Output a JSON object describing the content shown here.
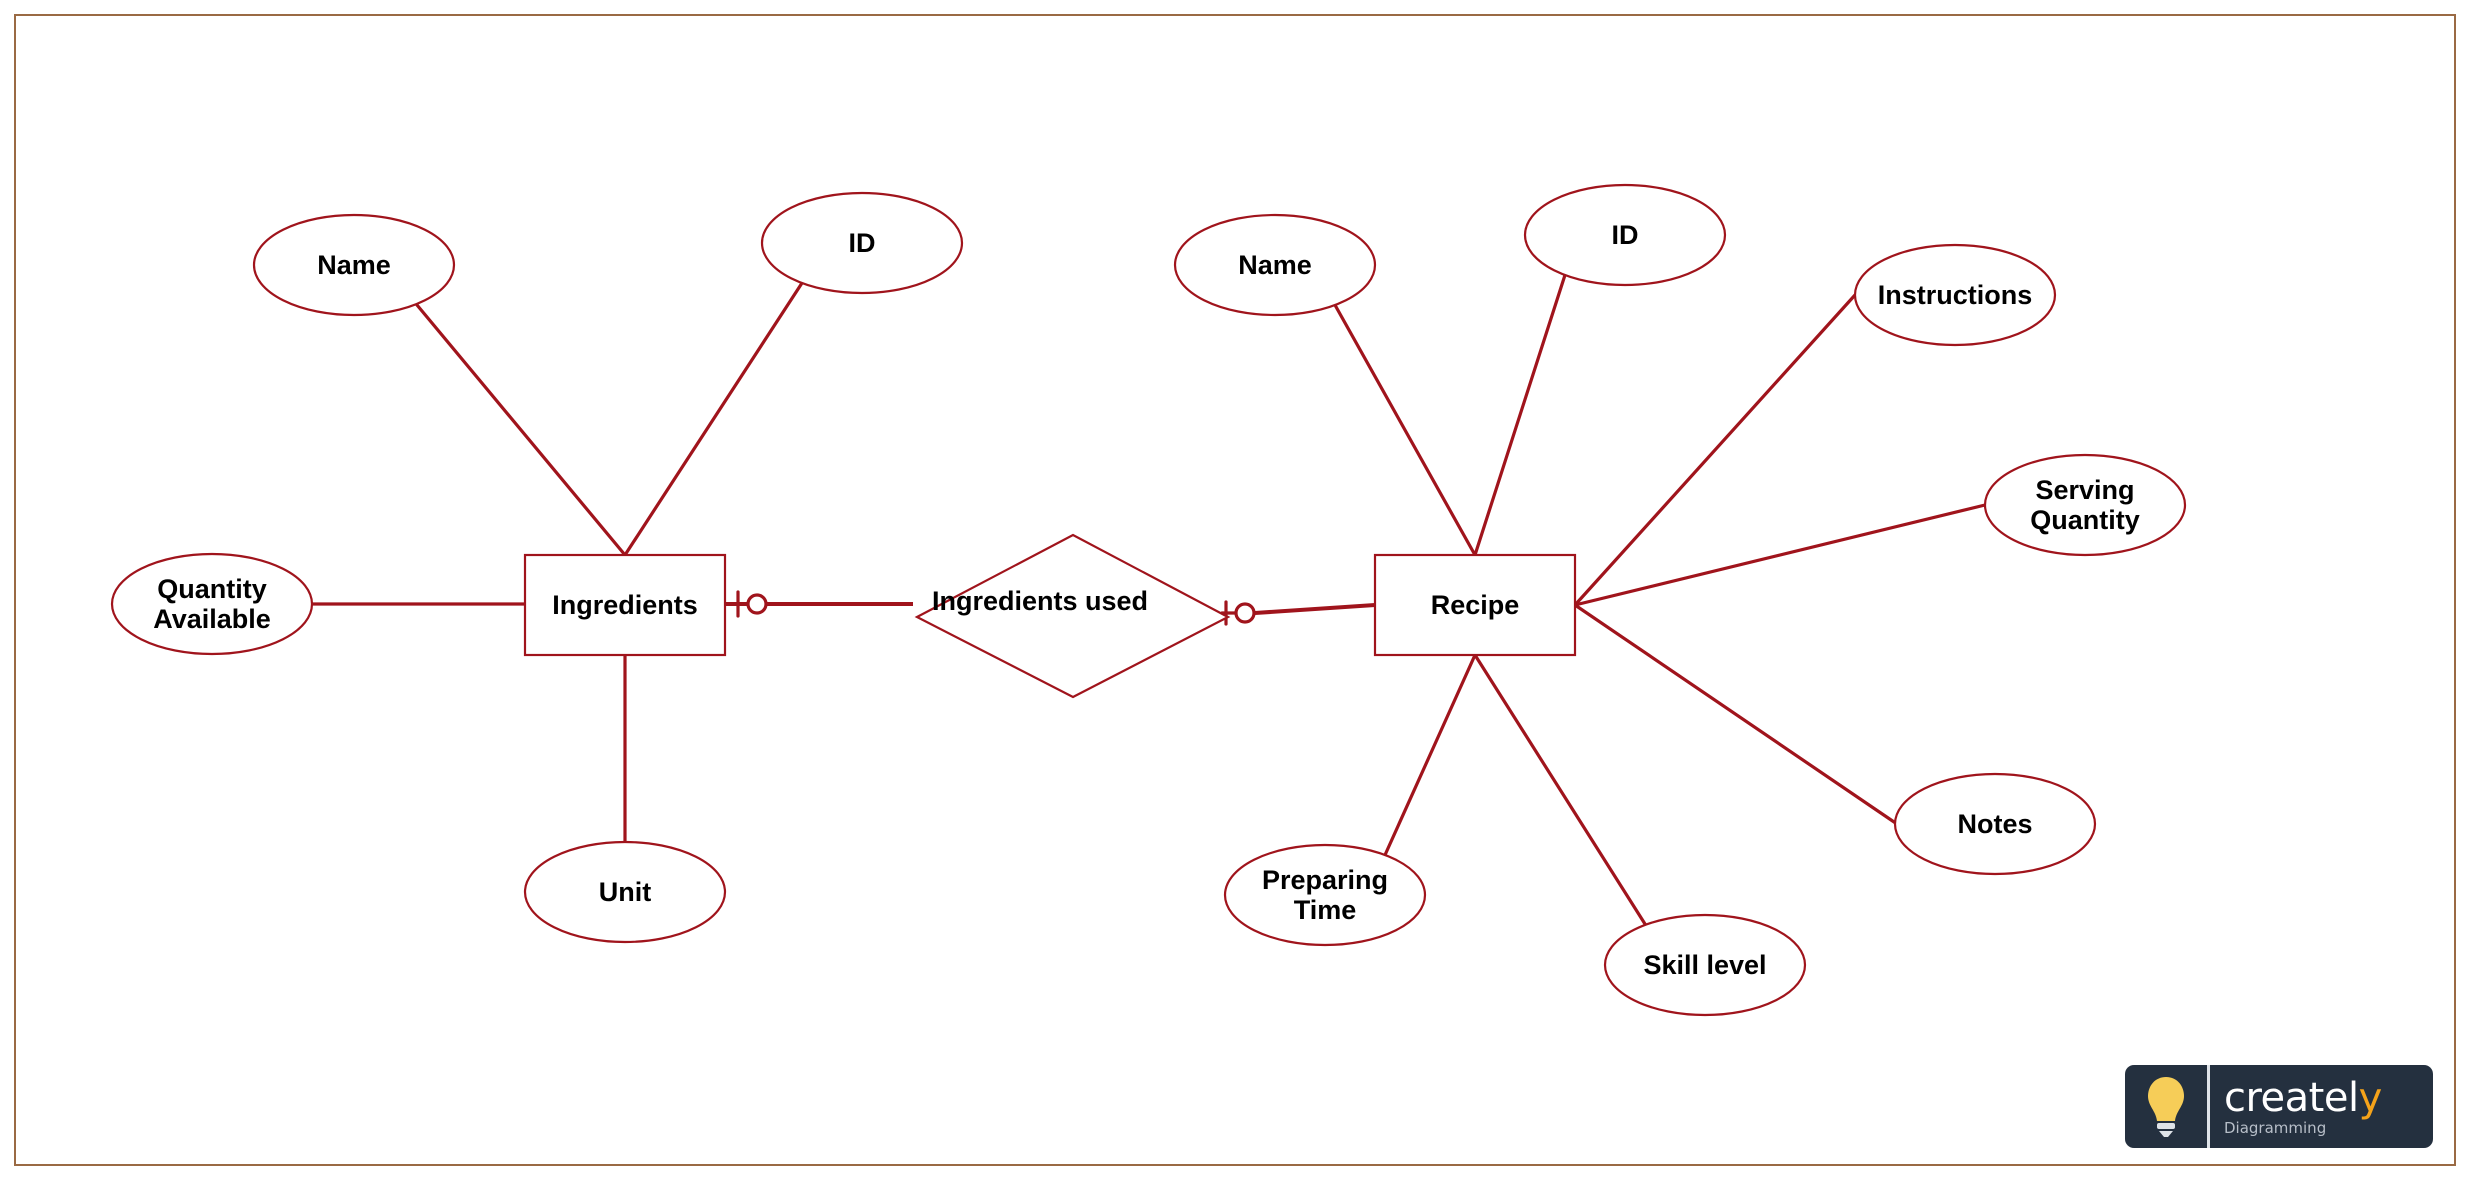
{
  "diagram": {
    "type": "er-diagram",
    "entities": [
      {
        "id": "ingredients",
        "label": "Ingredients"
      },
      {
        "id": "recipe",
        "label": "Recipe"
      }
    ],
    "relationships": [
      {
        "id": "ingredients_used",
        "label": "Ingredients used",
        "from": "ingredients",
        "to": "recipe",
        "cardinality_from": "zero-or-one",
        "cardinality_to": "zero-or-one"
      }
    ],
    "attributes": [
      {
        "id": "ing_name",
        "entity": "ingredients",
        "lines": [
          "Name"
        ]
      },
      {
        "id": "ing_id",
        "entity": "ingredients",
        "lines": [
          "ID"
        ]
      },
      {
        "id": "ing_qty",
        "entity": "ingredients",
        "lines": [
          "Quantity",
          "Available"
        ]
      },
      {
        "id": "ing_unit",
        "entity": "ingredients",
        "lines": [
          "Unit"
        ]
      },
      {
        "id": "rec_name",
        "entity": "recipe",
        "lines": [
          "Name"
        ]
      },
      {
        "id": "rec_id",
        "entity": "recipe",
        "lines": [
          "ID"
        ]
      },
      {
        "id": "rec_instr",
        "entity": "recipe",
        "lines": [
          "Instructions"
        ]
      },
      {
        "id": "rec_serving",
        "entity": "recipe",
        "lines": [
          "Serving",
          "Quantity"
        ]
      },
      {
        "id": "rec_notes",
        "entity": "recipe",
        "lines": [
          "Notes"
        ]
      },
      {
        "id": "rec_skill",
        "entity": "recipe",
        "lines": [
          "Skill level"
        ]
      },
      {
        "id": "rec_prep",
        "entity": "recipe",
        "lines": [
          "Preparing",
          "Time"
        ]
      }
    ]
  },
  "colors": {
    "shape_stroke": "#a0141c",
    "frame": "#9a6a44",
    "logo_bg": "#24303f",
    "logo_accent": "#f5a31a",
    "bulb": "#f6cd58"
  },
  "watermark": {
    "brand_main": "createl",
    "brand_accent": "y",
    "subtitle": "Diagramming"
  }
}
